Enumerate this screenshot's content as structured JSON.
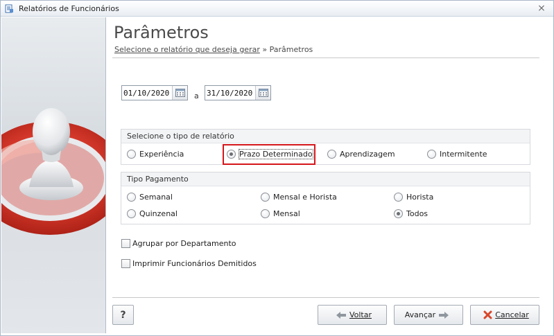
{
  "window": {
    "title": "Relatórios de Funcionários",
    "close_glyph": "⨯"
  },
  "header": {
    "title": "Parâmetros",
    "breadcrumb_link": "Selecione o relatório que deseja gerar",
    "breadcrumb_sep": " » ",
    "breadcrumb_current": "Parâmetros"
  },
  "dates": {
    "start": "01/10/2020",
    "separator": "a",
    "end": "31/10/2020"
  },
  "report_type": {
    "title": "Selecione o tipo de relatório",
    "options": [
      "Experiência",
      "Prazo Determinado",
      "Aprendizagem",
      "Intermitente"
    ],
    "selected": "Prazo Determinado"
  },
  "payment": {
    "title": "Tipo Pagamento",
    "options": [
      "Semanal",
      "Mensal e Horista",
      "Horista",
      "Quinzenal",
      "Mensal",
      "Todos"
    ],
    "selected": "Todos"
  },
  "checkboxes": {
    "group_by_department": "Agrupar por Departamento",
    "print_dismissed": "Imprimir Funcionários Demitidos"
  },
  "buttons": {
    "help": "?",
    "back": "Voltar",
    "next": "Avançar",
    "cancel": "Cancelar"
  },
  "colors": {
    "highlight": "#d4161b",
    "logo_red": "#c8281e"
  }
}
